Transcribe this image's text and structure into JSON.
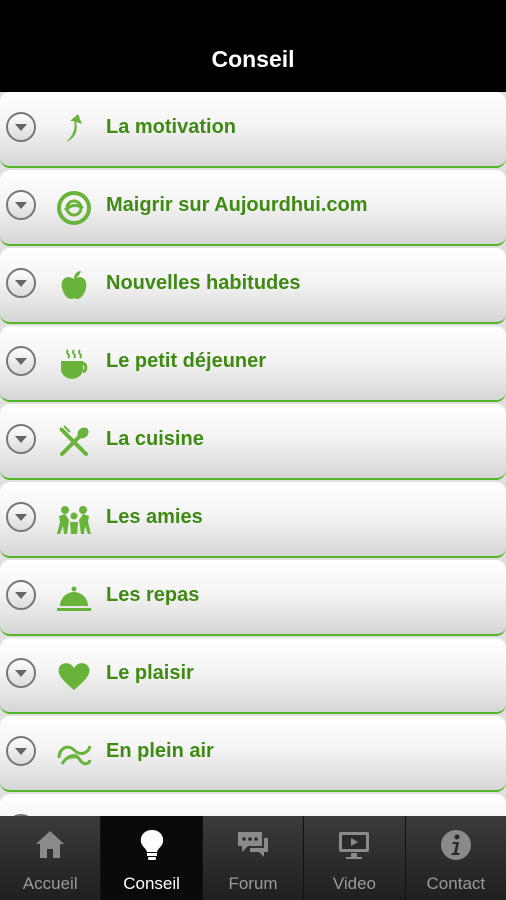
{
  "header": {
    "title": "Conseil"
  },
  "items": [
    {
      "label": "La motivation",
      "icon": "motivation-arrow-icon"
    },
    {
      "label": "Maigrir sur Aujourdhui.com",
      "icon": "aujourdhui-logo-icon"
    },
    {
      "label": "Nouvelles habitudes",
      "icon": "apple-icon"
    },
    {
      "label": "Le petit déjeuner",
      "icon": "coffee-cup-icon"
    },
    {
      "label": "La cuisine",
      "icon": "fork-spoon-icon"
    },
    {
      "label": "Les amies",
      "icon": "friends-icon"
    },
    {
      "label": "Les repas",
      "icon": "cloche-icon"
    },
    {
      "label": "Le plaisir",
      "icon": "heart-icon"
    },
    {
      "label": "En plein air",
      "icon": "leaf-icon"
    }
  ],
  "tabs": [
    {
      "label": "Accueil",
      "icon": "home-icon",
      "active": false
    },
    {
      "label": "Conseil",
      "icon": "lightbulb-icon",
      "active": true
    },
    {
      "label": "Forum",
      "icon": "chat-bubbles-icon",
      "active": false
    },
    {
      "label": "Video",
      "icon": "video-screen-icon",
      "active": false
    },
    {
      "label": "Contact",
      "icon": "info-icon",
      "active": false
    }
  ],
  "colors": {
    "accent": "#3f8a12",
    "icon_green": "#6ab33a",
    "divider": "#55b52a"
  }
}
